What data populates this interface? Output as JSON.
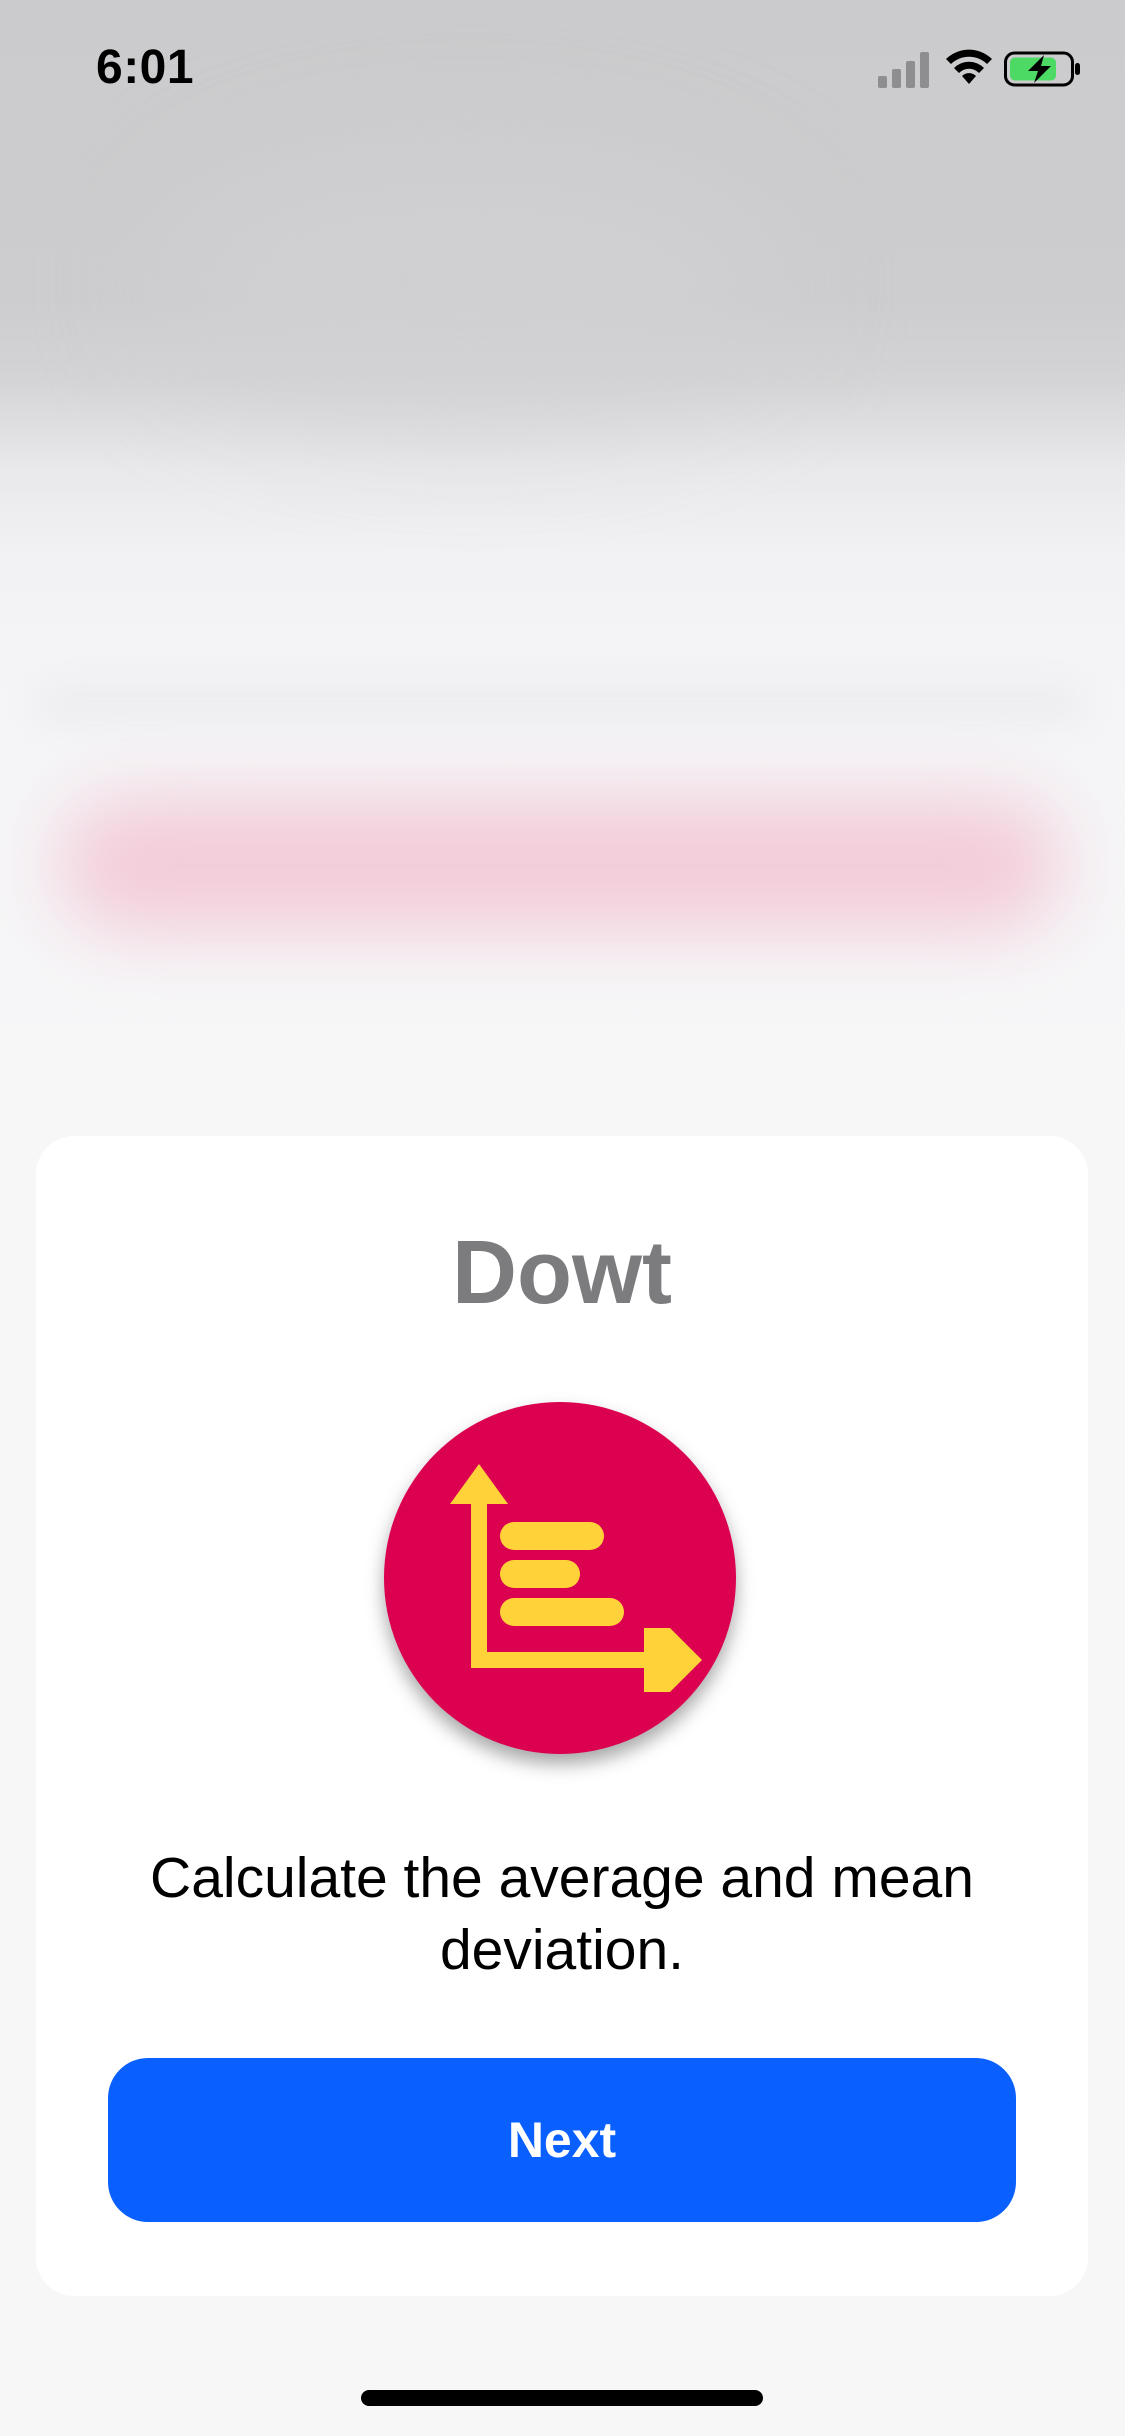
{
  "status_bar": {
    "time": "6:01",
    "signal_icon": "cellular-signal-icon",
    "wifi_icon": "wifi-icon",
    "battery_icon": "battery-charging-icon",
    "battery_color": "#4cd964"
  },
  "card": {
    "app_title": "Dowt",
    "logo_icon": "bar-chart-logo-icon",
    "logo_colors": {
      "background": "#dc0050",
      "foreground": "#ffd23a"
    },
    "description": "Calculate the average and mean deviation.",
    "next_button_label": "Next",
    "accent_color": "#0a60ff"
  },
  "home_indicator": "home-indicator"
}
